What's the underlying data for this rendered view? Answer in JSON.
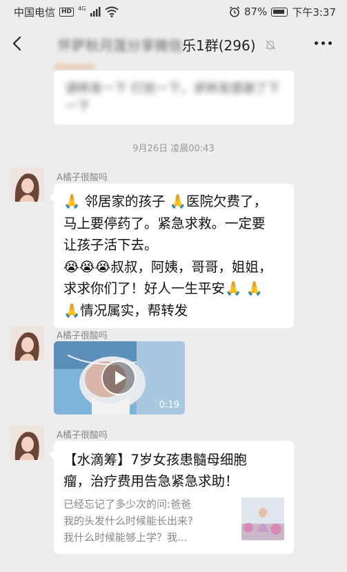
{
  "status_bar": {
    "carrier": "中国电信",
    "hd": "HD",
    "network": "4G",
    "battery": "87%",
    "time": "下午3:37"
  },
  "nav": {
    "title_blurred": "怀萨秋月莲分享微信",
    "title_visible": "乐1群(296)"
  },
  "top_message": {
    "text": "请转发一下 打扰一下，求转发感谢了下一下"
  },
  "timestamp": "9月26日 凌晨00:43",
  "messages": [
    {
      "nickname": "A橘子很酸吗",
      "lines": [
        "🙏 邻居家的孩子 🙏医院欠费了，",
        "马上要停药了。紧急求救。一定要",
        "让孩子活下去。",
        "😭😭😭叔叔，阿姨，哥哥，姐姐，",
        "求求你们了！好人一生平安🙏 🙏",
        "🙏情况属实，帮转发"
      ]
    },
    {
      "nickname": "A橘子很酸吗",
      "video_duration": "0:19"
    },
    {
      "nickname": "A橘子很酸吗",
      "link_title_lines": [
        "【水滴筹】7岁女孩患髓母细胞",
        "瘤，治疗费用告急紧急求助！"
      ],
      "link_desc_lines": [
        "已经忘记了多少次的问:爸爸",
        "我的头发什么时候能长出来?",
        "我什么时候能够上学？我..."
      ]
    }
  ],
  "colors": {
    "background": "#ededed",
    "bubble": "#ffffff",
    "meta_text": "#999999"
  }
}
